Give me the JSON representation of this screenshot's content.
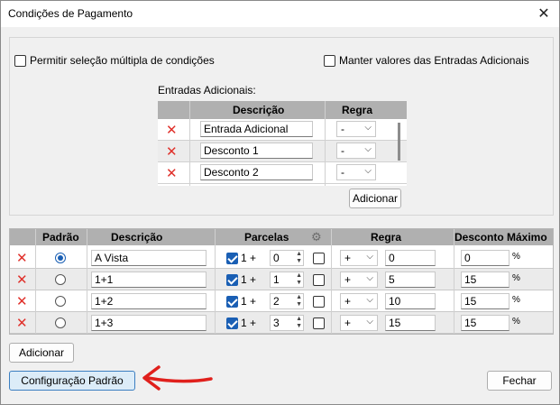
{
  "window": {
    "title": "Condições de Pagamento",
    "close_glyph": "✕"
  },
  "options": {
    "multi_select_label": "Permitir seleção múltipla de condições",
    "keep_values_label": "Manter valores das Entradas Adicionais"
  },
  "extras": {
    "caption": "Entradas Adicionais:",
    "headers": {
      "descricao": "Descrição",
      "regra": "Regra"
    },
    "rows": [
      {
        "descricao": "Entrada Adicional",
        "regra": "-"
      },
      {
        "descricao": "Desconto 1",
        "regra": "-"
      },
      {
        "descricao": "Desconto 2",
        "regra": "-"
      }
    ],
    "add_label": "Adicionar"
  },
  "conditions": {
    "headers": {
      "padrao": "Padrão",
      "descricao": "Descrição",
      "parcelas": "Parcelas",
      "regra": "Regra",
      "desconto_max": "Desconto Máximo"
    },
    "rows": [
      {
        "padrao": true,
        "descricao": "A Vista",
        "parcelas_prefix": "1 +",
        "parcelas": "0",
        "regra": "+",
        "regra_val": "0",
        "desconto": "0",
        "pct": "%"
      },
      {
        "padrao": false,
        "descricao": "1+1",
        "parcelas_prefix": "1 +",
        "parcelas": "1",
        "regra": "+",
        "regra_val": "5",
        "desconto": "15",
        "pct": "%"
      },
      {
        "padrao": false,
        "descricao": "1+2",
        "parcelas_prefix": "1 +",
        "parcelas": "2",
        "regra": "+",
        "regra_val": "10",
        "desconto": "15",
        "pct": "%"
      },
      {
        "padrao": false,
        "descricao": "1+3",
        "parcelas_prefix": "1 +",
        "parcelas": "3",
        "regra": "+",
        "regra_val": "15",
        "desconto": "15",
        "pct": "%"
      }
    ]
  },
  "footer": {
    "add_label": "Adicionar",
    "default_config_label": "Configuração Padrão",
    "close_label": "Fechar"
  },
  "colors": {
    "delete_icon": "#e0302a",
    "annotation_arrow": "#e0201c",
    "accent": "#1a5fb4"
  },
  "icons": {
    "delete": "delete-icon",
    "settings": "gear-icon",
    "annotation": "red-arrow-icon"
  }
}
